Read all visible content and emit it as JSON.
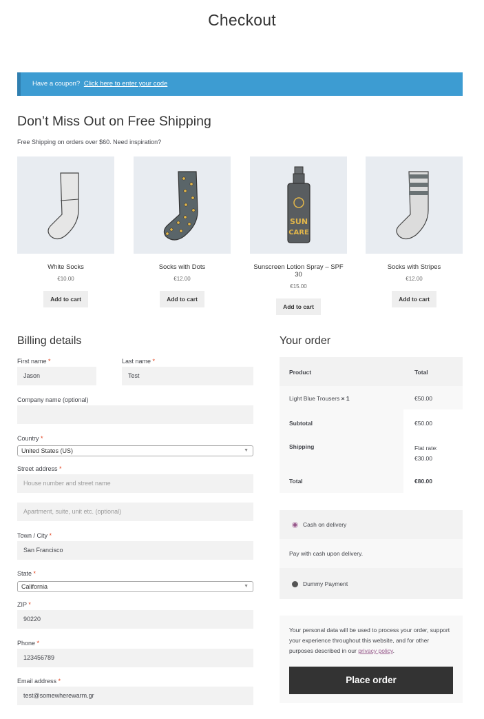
{
  "page": {
    "title": "Checkout"
  },
  "coupon": {
    "text": "Have a coupon?",
    "link": "Click here to enter your code"
  },
  "promo": {
    "title": "Don’t Miss Out on Free Shipping",
    "subtitle": "Free Shipping on orders over $60. Need inspiration?",
    "products": [
      {
        "name": "White Socks",
        "price": "€10.00",
        "button": "Add to cart",
        "icon": "white-sock-icon"
      },
      {
        "name": "Socks with Dots",
        "price": "€12.00",
        "button": "Add to cart",
        "icon": "dotted-sock-icon"
      },
      {
        "name": "Sunscreen Lotion Spray – SPF 30",
        "price": "€15.00",
        "button": "Add to cart",
        "icon": "sunscreen-bottle-icon"
      },
      {
        "name": "Socks with Stripes",
        "price": "€12.00",
        "button": "Add to cart",
        "icon": "striped-sock-icon"
      }
    ]
  },
  "billing": {
    "title": "Billing details",
    "required_mark": "*",
    "first_name": {
      "label": "First name",
      "value": "Jason"
    },
    "last_name": {
      "label": "Last name",
      "value": "Test"
    },
    "company": {
      "label": "Company name (optional)",
      "value": ""
    },
    "country": {
      "label": "Country",
      "value": "United States (US)"
    },
    "street": {
      "label": "Street address",
      "placeholder1": "House number and street name",
      "placeholder2": "Apartment, suite, unit etc. (optional)"
    },
    "city": {
      "label": "Town / City",
      "value": "San Francisco"
    },
    "state": {
      "label": "State",
      "value": "California"
    },
    "zip": {
      "label": "ZIP",
      "value": "90220"
    },
    "phone": {
      "label": "Phone",
      "value": "123456789"
    },
    "email": {
      "label": "Email address",
      "value": "test@somewherewarm.gr"
    }
  },
  "order": {
    "title": "Your order",
    "head_product": "Product",
    "head_total": "Total",
    "item_name": "Light Blue Trousers",
    "item_qty": "× 1",
    "item_total": "€50.00",
    "subtotal_label": "Subtotal",
    "subtotal_value": "€50.00",
    "shipping_label": "Shipping",
    "shipping_value_line1": "Flat rate:",
    "shipping_value_line2": "€30.00",
    "total_label": "Total",
    "total_value": "€80.00"
  },
  "payment": {
    "cod_label": "Cash on delivery",
    "cod_desc": "Pay with cash upon delivery.",
    "dummy_label": "Dummy Payment",
    "selected_color": "#96588a",
    "unselected_color": "#555555"
  },
  "privacy": {
    "text": "Your personal data will be used to process your order, support your experience throughout this website, and for other purposes described in our",
    "link": "privacy policy",
    "period": "."
  },
  "place_order": {
    "label": "Place order"
  },
  "colors": {
    "coupon_bg": "#3d9cd2",
    "button_dark": "#333333",
    "required": "#e2401c"
  }
}
